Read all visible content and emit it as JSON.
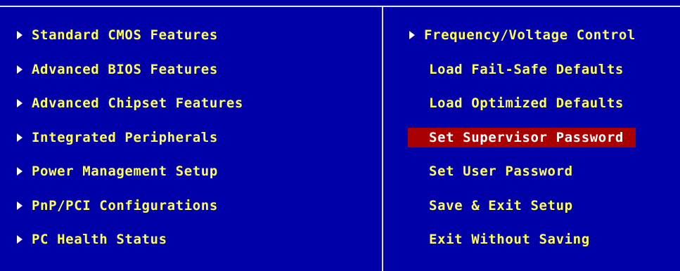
{
  "left_menu": [
    {
      "label": "Standard CMOS Features",
      "submenu": true
    },
    {
      "label": "Advanced BIOS Features",
      "submenu": true
    },
    {
      "label": "Advanced Chipset Features",
      "submenu": true
    },
    {
      "label": "Integrated Peripherals",
      "submenu": true
    },
    {
      "label": "Power Management Setup",
      "submenu": true
    },
    {
      "label": "PnP/PCI Configurations",
      "submenu": true
    },
    {
      "label": "PC Health Status",
      "submenu": true
    }
  ],
  "right_menu": [
    {
      "label": "Frequency/Voltage Control",
      "submenu": true
    },
    {
      "label": "Load Fail-Safe Defaults",
      "submenu": false
    },
    {
      "label": "Load Optimized Defaults",
      "submenu": false
    },
    {
      "label": "Set Supervisor Password",
      "submenu": false,
      "selected": true
    },
    {
      "label": "Set User Password",
      "submenu": false
    },
    {
      "label": "Save & Exit Setup",
      "submenu": false
    },
    {
      "label": "Exit Without Saving",
      "submenu": false
    }
  ],
  "colors": {
    "background": "#0000a8",
    "text": "#ffff55",
    "arrow": "#ffffff",
    "selected_background": "#a80000",
    "selected_text": "#ffffff",
    "frame": "#e8e8e8"
  },
  "icons": {
    "submenu": "right-triangle-icon"
  }
}
